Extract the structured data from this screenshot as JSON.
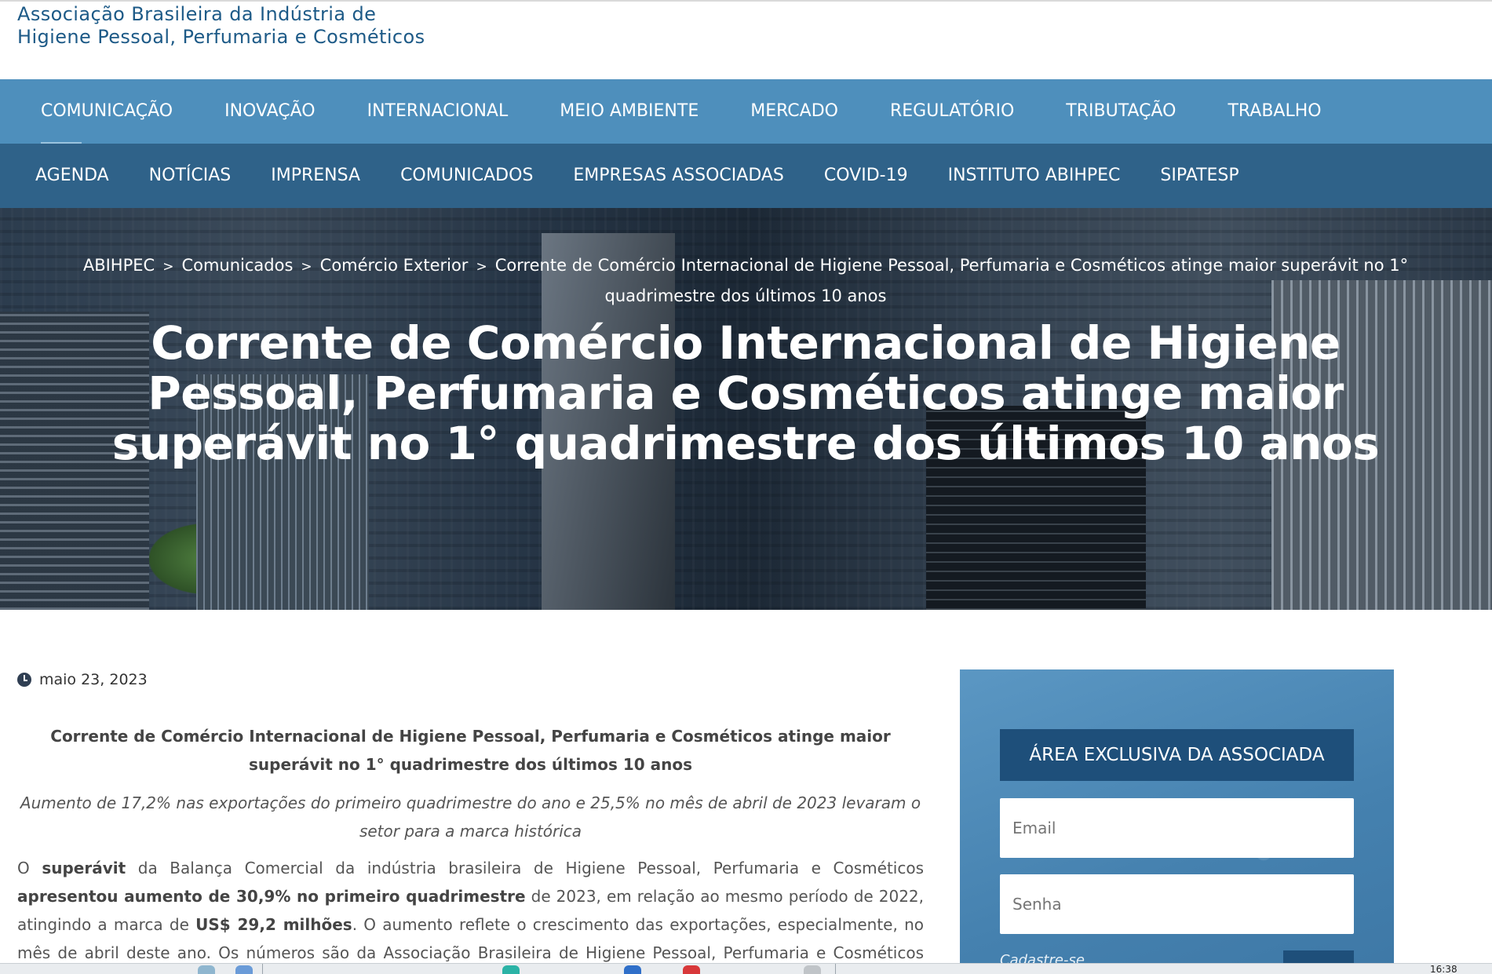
{
  "header": {
    "logo_line1": "Associação Brasileira da Indústria de",
    "logo_line2": "Higiene Pessoal, Perfumaria e Cosméticos"
  },
  "nav_primary": [
    {
      "label": "COMUNICAÇÃO",
      "active": true
    },
    {
      "label": "INOVAÇÃO"
    },
    {
      "label": "INTERNACIONAL"
    },
    {
      "label": "MEIO AMBIENTE"
    },
    {
      "label": "MERCADO"
    },
    {
      "label": "REGULATÓRIO"
    },
    {
      "label": "TRIBUTAÇÃO"
    },
    {
      "label": "TRABALHO"
    }
  ],
  "nav_secondary": [
    {
      "label": "AGENDA"
    },
    {
      "label": "NOTÍCIAS"
    },
    {
      "label": "IMPRENSA"
    },
    {
      "label": "COMUNICADOS"
    },
    {
      "label": "EMPRESAS ASSOCIADAS"
    },
    {
      "label": "COVID-19"
    },
    {
      "label": "INSTITUTO ABIHPEC"
    },
    {
      "label": "SIPATESP"
    }
  ],
  "breadcrumb": {
    "items": [
      "ABIHPEC",
      "Comunicados",
      "Comércio Exterior",
      "Corrente de Comércio Internacional de Higiene Pessoal, Perfumaria e Cosméticos atinge maior superávit no 1° quadrimestre dos últimos 10 anos"
    ],
    "separator": ">"
  },
  "hero": {
    "title": "Corrente de Comércio Internacional de Higiene Pessoal, Perfumaria e Cosméticos atinge maior superávit no 1° quadrimestre dos últimos 10 anos"
  },
  "article": {
    "date": "maio 23, 2023",
    "heading": "Corrente de Comércio Internacional de Higiene Pessoal, Perfumaria e Cosméticos atinge maior superávit no 1° quadrimestre dos últimos 10 anos",
    "subtitle": "Aumento de 17,2% nas exportações do primeiro quadrimestre do ano e 25,5% no mês de abril de 2023 levaram o setor para a marca histórica",
    "body": {
      "t1": "O ",
      "b1": "superávit",
      "t2": " da Balança Comercial da indústria brasileira de Higiene Pessoal, Perfumaria e Cosméticos ",
      "b2": "apresentou aumento de 30,9% no primeiro quadrimestre",
      "t3": " de 2023, em relação ao mesmo período de 2022, atingindo a marca de ",
      "b3": "US$ 29,2 milhões",
      "t4": ". O aumento reflete o crescimento das exportações, especialmente, no mês de abril deste ano. Os números são da Associação Brasileira de Higiene Pessoal, Perfumaria e Cosméticos (ABIHPEC)."
    }
  },
  "sidebar": {
    "area_title": "ÁREA EXCLUSIVA DA ASSOCIADA",
    "email_placeholder": "Email",
    "senha_placeholder": "Senha",
    "cadastre_label": "Cadastre-se"
  },
  "taskbar": {
    "clock": "16:38"
  }
}
